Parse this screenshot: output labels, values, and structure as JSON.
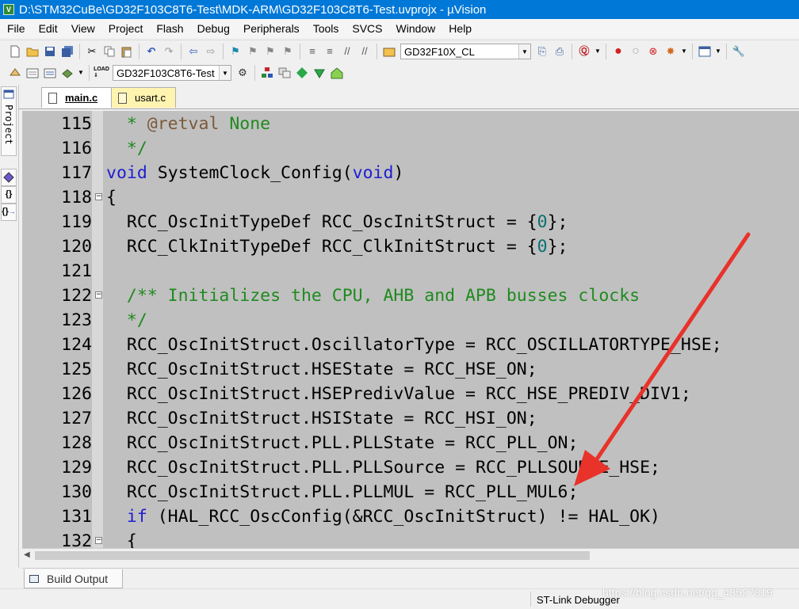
{
  "window": {
    "title": "D:\\STM32CuBe\\GD32F103C8T6-Test\\MDK-ARM\\GD32F103C8T6-Test.uvprojx - µVision",
    "app_icon_label": "V"
  },
  "menu": [
    "File",
    "Edit",
    "View",
    "Project",
    "Flash",
    "Debug",
    "Peripherals",
    "Tools",
    "SVCS",
    "Window",
    "Help"
  ],
  "toolbar": {
    "device_target": "GD32F10X_CL",
    "project_target": "GD32F103C8T6-Test"
  },
  "left_panel": {
    "project_label": "Project",
    "functions_label": "{}",
    "templates_label": "{}"
  },
  "tabs": [
    {
      "label": "main.c",
      "active": true
    },
    {
      "label": "usart.c",
      "active": false
    }
  ],
  "code": [
    {
      "n": "115",
      "fold": false,
      "parts": [
        {
          "t": "  * ",
          "c": "cm"
        },
        {
          "t": "@retval",
          "c": "tag"
        },
        {
          "t": " None",
          "c": "cm"
        }
      ]
    },
    {
      "n": "116",
      "fold": false,
      "parts": [
        {
          "t": "  */",
          "c": "cm"
        }
      ]
    },
    {
      "n": "117",
      "fold": false,
      "parts": [
        {
          "t": "void",
          "c": "kw"
        },
        {
          "t": " SystemClock_Config(",
          "c": ""
        },
        {
          "t": "void",
          "c": "kw"
        },
        {
          "t": ")",
          "c": ""
        }
      ]
    },
    {
      "n": "118",
      "fold": true,
      "parts": [
        {
          "t": "{",
          "c": ""
        }
      ]
    },
    {
      "n": "119",
      "fold": false,
      "parts": [
        {
          "t": "  RCC_OscInitTypeDef RCC_OscInitStruct = {",
          "c": ""
        },
        {
          "t": "0",
          "c": "num"
        },
        {
          "t": "};",
          "c": ""
        }
      ]
    },
    {
      "n": "120",
      "fold": false,
      "parts": [
        {
          "t": "  RCC_ClkInitTypeDef RCC_ClkInitStruct = {",
          "c": ""
        },
        {
          "t": "0",
          "c": "num"
        },
        {
          "t": "};",
          "c": ""
        }
      ]
    },
    {
      "n": "121",
      "fold": false,
      "parts": [
        {
          "t": "",
          "c": ""
        }
      ]
    },
    {
      "n": "122",
      "fold": true,
      "parts": [
        {
          "t": "  /** Initializes the CPU, AHB and APB busses clocks",
          "c": "cm"
        }
      ]
    },
    {
      "n": "123",
      "fold": false,
      "parts": [
        {
          "t": "  */",
          "c": "cm"
        }
      ]
    },
    {
      "n": "124",
      "fold": false,
      "parts": [
        {
          "t": "  RCC_OscInitStruct.OscillatorType = RCC_OSCILLATORTYPE_HSE;",
          "c": ""
        }
      ]
    },
    {
      "n": "125",
      "fold": false,
      "parts": [
        {
          "t": "  RCC_OscInitStruct.HSEState = RCC_HSE_ON;",
          "c": ""
        }
      ]
    },
    {
      "n": "126",
      "fold": false,
      "parts": [
        {
          "t": "  RCC_OscInitStruct.HSEPredivValue = RCC_HSE_PREDIV_DIV1;",
          "c": ""
        }
      ]
    },
    {
      "n": "127",
      "fold": false,
      "parts": [
        {
          "t": "  RCC_OscInitStruct.HSIState = RCC_HSI_ON;",
          "c": ""
        }
      ]
    },
    {
      "n": "128",
      "fold": false,
      "parts": [
        {
          "t": "  RCC_OscInitStruct.PLL.PLLState = RCC_PLL_ON;",
          "c": ""
        }
      ]
    },
    {
      "n": "129",
      "fold": false,
      "parts": [
        {
          "t": "  RCC_OscInitStruct.PLL.PLLSource = RCC_PLLSOURCE_HSE;",
          "c": ""
        }
      ]
    },
    {
      "n": "130",
      "fold": false,
      "parts": [
        {
          "t": "  RCC_OscInitStruct.PLL.PLLMUL = RCC_PLL_MUL6;",
          "c": ""
        }
      ]
    },
    {
      "n": "131",
      "fold": false,
      "parts": [
        {
          "t": "  ",
          "c": ""
        },
        {
          "t": "if",
          "c": "kw"
        },
        {
          "t": " (HAL_RCC_OscConfig(&RCC_OscInitStruct) != HAL_OK)",
          "c": ""
        }
      ]
    },
    {
      "n": "132",
      "fold": true,
      "parts": [
        {
          "t": "  {",
          "c": ""
        }
      ]
    }
  ],
  "bottom": {
    "build_output_tab": "Build Output"
  },
  "status": {
    "debugger": "ST-Link Debugger",
    "watermark": "https://blog.csdn.net/qq_43527819"
  },
  "colors": {
    "editor_bg": "#c0c0c0",
    "keyword": "#1e1ed2",
    "comment": "#1f8a1f",
    "annotation_arrow": "#e8322a"
  }
}
